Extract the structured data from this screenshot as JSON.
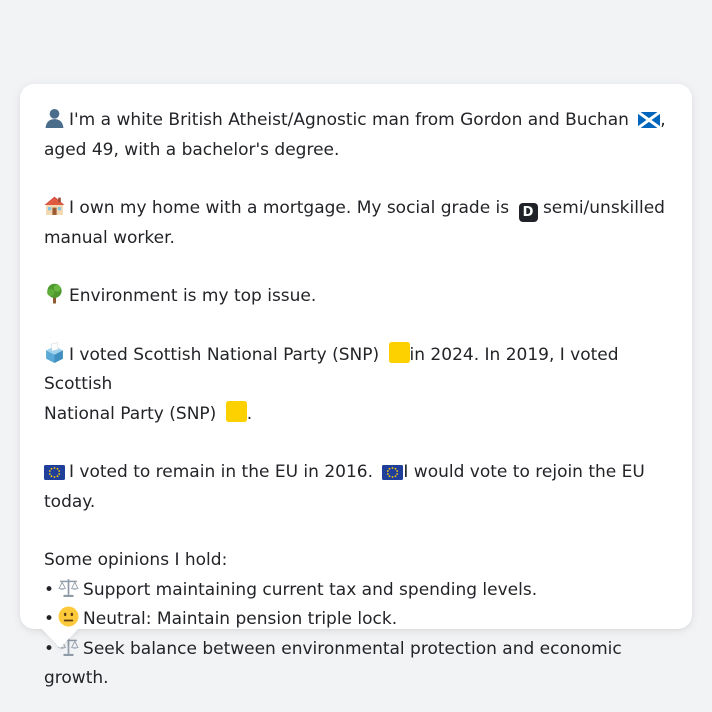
{
  "profile": {
    "intro": {
      "icon": "person-silhouette-icon",
      "text_a": "I'm a white British Atheist/Agnostic man from Gordon and Buchan",
      "flag_icon": "scotland-flag-icon",
      "text_b": ",",
      "text_c": "aged 49, with a bachelor's degree."
    },
    "home": {
      "icon": "house-icon",
      "text_a": "I own my home with a mortgage. My social grade is",
      "grade_icon": "letter-d-square-icon",
      "grade_letter": "D",
      "text_b": "semi/unskilled",
      "text_c": "manual worker."
    },
    "issue": {
      "icon": "tree-icon",
      "text": "Environment is my top issue."
    },
    "vote": {
      "icon": "ballot-box-icon",
      "text_a": "I voted Scottish National Party (SNP)",
      "party_icon": "yellow-square-icon",
      "party_color": "#fdd000",
      "text_b": "in 2024. In 2019, I voted Scottish",
      "text_c": "National Party (SNP)",
      "text_d": "."
    },
    "eu": {
      "icon": "eu-flag-icon",
      "text_a": "I voted to remain in the EU in 2016.",
      "text_b": "I would vote to rejoin the EU today."
    },
    "opinions": {
      "heading": "Some opinions I hold:",
      "bullet": "•",
      "items": [
        {
          "icon": "balance-scale-icon",
          "text": "Support maintaining current tax and spending levels."
        },
        {
          "icon": "neutral-face-icon",
          "text": "Neutral: Maintain pension triple lock."
        },
        {
          "icon": "balance-scale-icon",
          "text": "Seek balance between environmental protection and economic growth."
        }
      ]
    }
  }
}
